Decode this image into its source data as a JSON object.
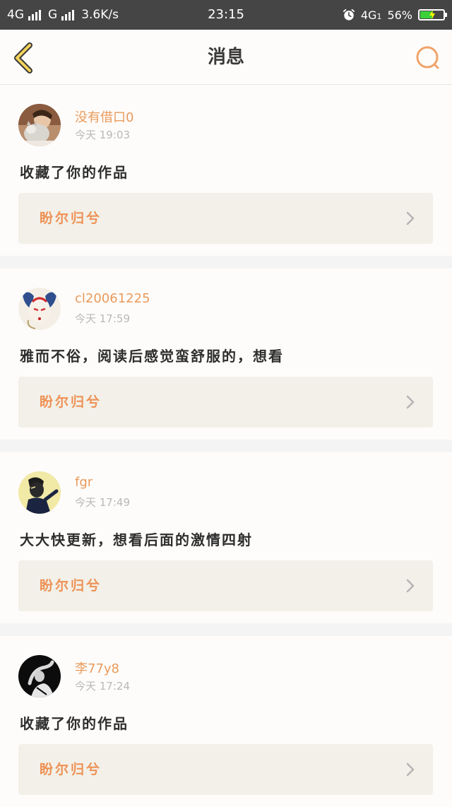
{
  "status_bar": {
    "network1": "4G",
    "network2": "G",
    "speed": "3.6K/s",
    "time": "23:15",
    "network_right": "4G",
    "network_right_sub": "1",
    "battery": "56%",
    "battery_level": 0.56
  },
  "nav": {
    "title": "消息",
    "back_icon": "chevron-left-icon",
    "search_icon": "search-icon"
  },
  "messages": [
    {
      "username": "没有借口0",
      "time": "今天 19:03",
      "comment": "收藏了你的作品",
      "work_title": "盼尔归兮"
    },
    {
      "username": "cl20061225",
      "time": "今天 17:59",
      "comment": "雅而不俗，阅读后感觉蛮舒服的，想看",
      "work_title": "盼尔归兮"
    },
    {
      "username": "fgr",
      "time": "今天 17:49",
      "comment": "大大快更新，想看后面的激情四射",
      "work_title": "盼尔归兮"
    },
    {
      "username": "李77y8",
      "time": "今天 17:24",
      "comment": "收藏了你的作品",
      "work_title": "盼尔归兮"
    }
  ],
  "colors": {
    "accent": "#e99a5b",
    "status_bar_bg": "#454545",
    "card_bg": "#fefcfa",
    "link_bg": "#f2f0e8"
  }
}
